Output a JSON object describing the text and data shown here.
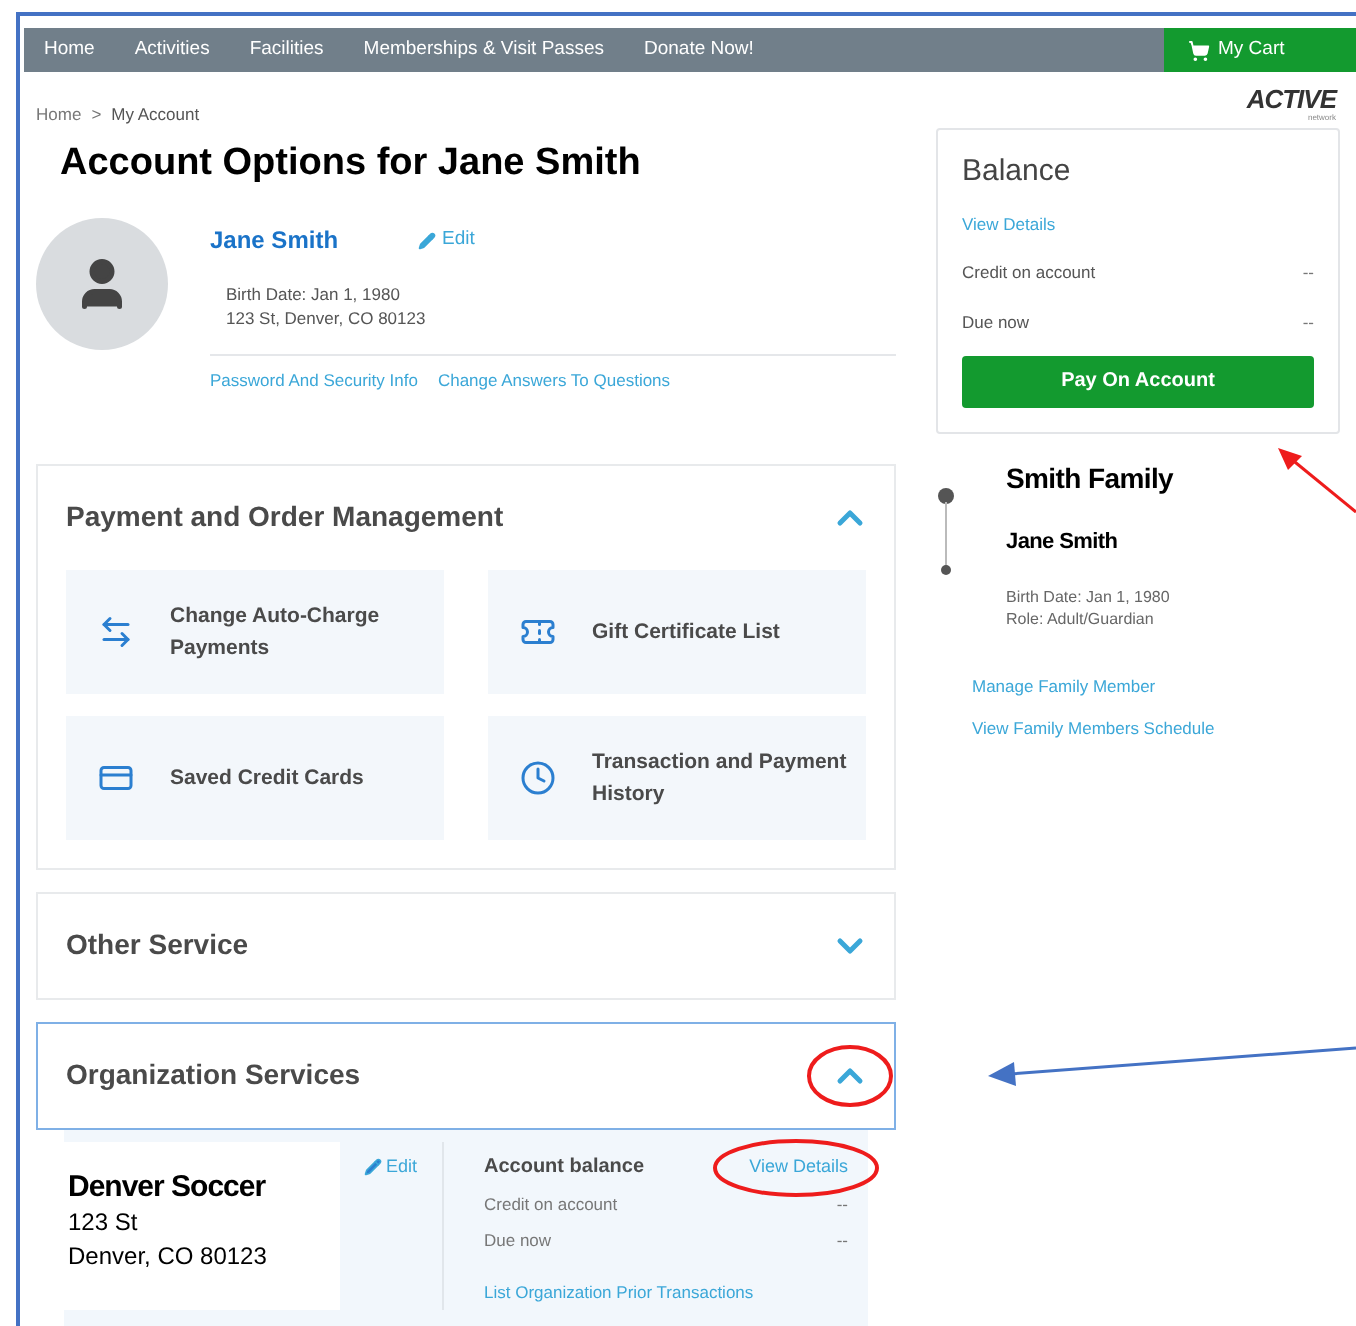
{
  "nav": {
    "items": [
      {
        "label": "Home"
      },
      {
        "label": "Activities"
      },
      {
        "label": "Facilities"
      },
      {
        "label": "Memberships & Visit Passes"
      },
      {
        "label": "Donate Now!"
      }
    ],
    "cart": "My Cart"
  },
  "breadcrumb": {
    "items": [
      "Home",
      "My Account"
    ],
    "separator": ">"
  },
  "logo": {
    "text": "ACTIVE",
    "subtext": "network"
  },
  "title": "Account Options for Jane Smith",
  "profile": {
    "name": "Jane Smith",
    "edit": "Edit",
    "birth_date": "Birth Date: Jan 1, 1980",
    "address": "123 St, Denver, CO 80123",
    "links": [
      "Password And Security Info",
      "Change Answers To Questions"
    ]
  },
  "sections": [
    {
      "title": "Payment and Order Management",
      "expanded": true,
      "focused": false,
      "tiles": [
        {
          "label": "Change Auto-Charge Payments"
        },
        {
          "label": "Gift Certificate List"
        },
        {
          "label": "Saved Credit Cards"
        },
        {
          "label": "Transaction and Payment History"
        }
      ]
    },
    {
      "title": "Other Service",
      "expanded": false,
      "focused": false
    },
    {
      "title": "Organization Services",
      "expanded": true,
      "focused": true,
      "organization": {
        "name": "Denver Soccer",
        "address_lines": [
          "123 St",
          "Denver, CO 80123"
        ],
        "edit": "Edit",
        "balance_title": "Account balance",
        "view_details": "View Details",
        "rows": [
          {
            "label": "Credit on account",
            "value": "--"
          },
          {
            "label": "Due now",
            "value": "--"
          }
        ],
        "link": "List Organization Prior Transactions"
      }
    }
  ],
  "balance": {
    "title": "Balance",
    "view_details": "View Details",
    "rows": [
      {
        "label": "Credit on account",
        "value": "--"
      },
      {
        "label": "Due now",
        "value": "--"
      }
    ],
    "button": "Pay On Account"
  },
  "family": {
    "name": "Smith Family",
    "member": {
      "name": "Jane Smith",
      "birth_date": "Birth Date: Jan 1, 1980",
      "role": "Role: Adult/Guardian"
    },
    "links": [
      "Manage Family Member",
      "View Family Members Schedule"
    ]
  }
}
